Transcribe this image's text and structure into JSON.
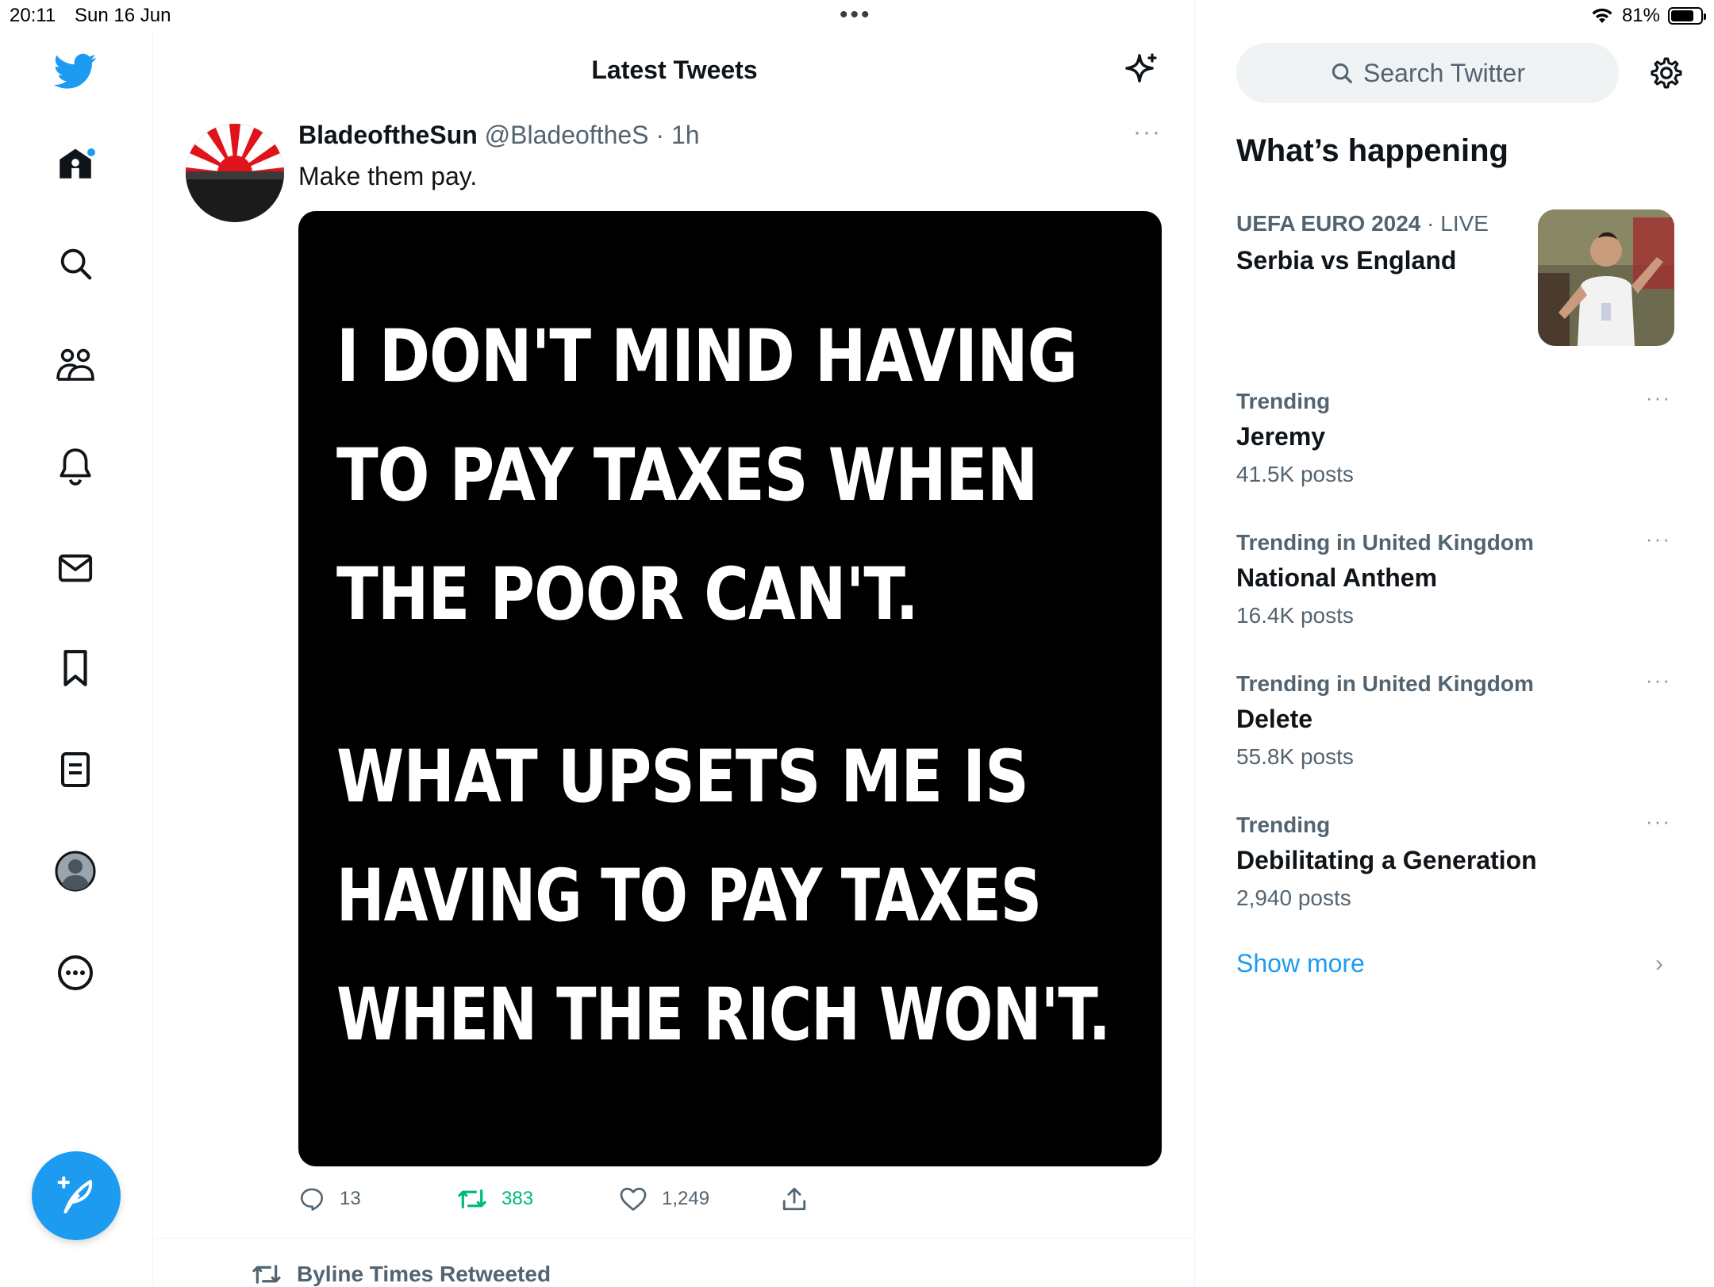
{
  "status_bar": {
    "time": "20:11",
    "date": "Sun 16 Jun",
    "battery": "81%"
  },
  "header": {
    "title": "Latest Tweets"
  },
  "nav": {
    "items": [
      "twitter-logo",
      "home",
      "explore",
      "communities",
      "notifications",
      "messages",
      "bookmarks",
      "lists",
      "profile",
      "more"
    ]
  },
  "tweet": {
    "name": "BladeoftheSun",
    "handle": "@BladeoftheS",
    "time": "· 1h",
    "more": "···",
    "text": "Make them pay.",
    "image_lines": [
      "I DON'T MIND HAVING",
      "TO PAY TAXES WHEN",
      "THE POOR CAN'T.",
      "WHAT UPSETS ME IS",
      "HAVING TO PAY TAXES",
      "WHEN THE RICH WON'T."
    ],
    "replies": "13",
    "retweets": "383",
    "likes": "1,249"
  },
  "next_tweet": {
    "retweeted_by": "Byline Times Retweeted"
  },
  "search": {
    "placeholder": "Search Twitter"
  },
  "whats_happening": {
    "title": "What’s happening",
    "live": {
      "category": "UEFA EURO 2024",
      "suffix": " · LIVE",
      "title": "Serbia vs England"
    },
    "trends": [
      {
        "category": "Trending",
        "name": "Jeremy",
        "posts": "41.5K posts"
      },
      {
        "category": "Trending in United Kingdom",
        "name": "National Anthem",
        "posts": "16.4K posts"
      },
      {
        "category": "Trending in United Kingdom",
        "name": "Delete",
        "posts": "55.8K posts"
      },
      {
        "category": "Trending",
        "name": "Debilitating a Generation",
        "posts": "2,940 posts"
      }
    ],
    "trend_more": "···",
    "show_more": "Show more"
  },
  "colors": {
    "accent": "#1d9bf0",
    "retweet_green": "#00ba7c",
    "muted": "#536471"
  }
}
